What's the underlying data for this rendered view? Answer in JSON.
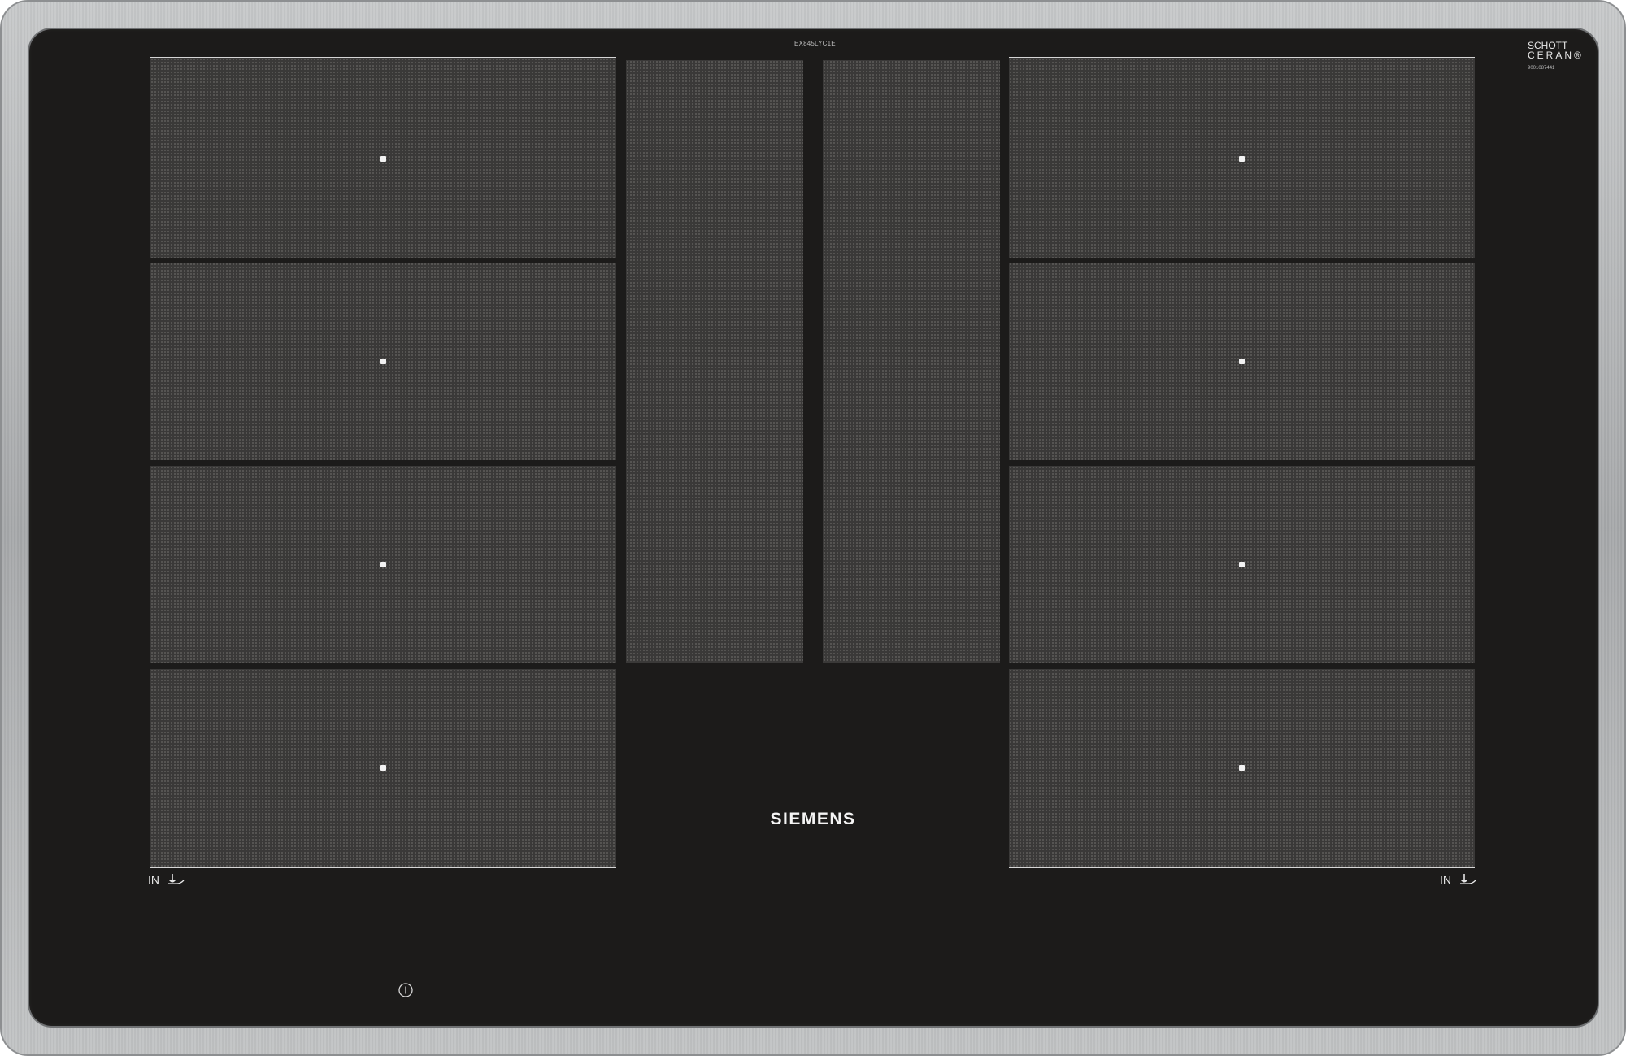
{
  "product": {
    "model_number": "EX845LYC1E",
    "brand": "SIEMENS",
    "glass_logo_line1": "SCHOTT",
    "glass_logo_line2": "CERAN®",
    "serial": "9001087441"
  },
  "left_area": {
    "induction_label": "IN",
    "pot_symbol": "cookware-icon",
    "zones": 4
  },
  "right_area": {
    "induction_label": "IN",
    "pot_symbol": "cookware-icon",
    "zones": 4
  },
  "center_area": {
    "zones": 2
  },
  "controls": {
    "info_symbol": "info-icon"
  },
  "colors": {
    "glass": "#1c1b1a",
    "zone": "#3a3938",
    "frame": "#b5b7b9",
    "text": "#f4f4f4"
  }
}
